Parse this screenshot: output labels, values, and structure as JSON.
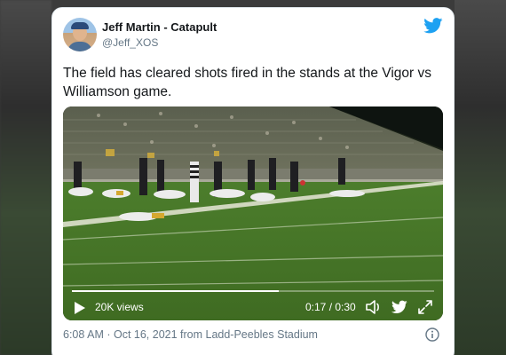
{
  "tweet": {
    "author_name": "Jeff Martin - Catapult",
    "handle": "@Jeff_XOS",
    "text": "The field has cleared shots fired in the stands at the Vigor vs Williamson game.",
    "meta": "6:08 AM · Oct 16, 2021 from Ladd-Peebles Stadium"
  },
  "video": {
    "views": "20K views",
    "time": "0:17 / 0:30",
    "progress": 0.57
  },
  "icons": {
    "brand": "twitter-bird-icon",
    "play": "play-icon",
    "volume": "volume-icon",
    "share": "twitter-bird-icon",
    "fullscreen": "fullscreen-icon",
    "info": "info-icon"
  },
  "colors": {
    "brand": "#1da1f2",
    "text": "#14171a",
    "secondary": "#657786"
  }
}
